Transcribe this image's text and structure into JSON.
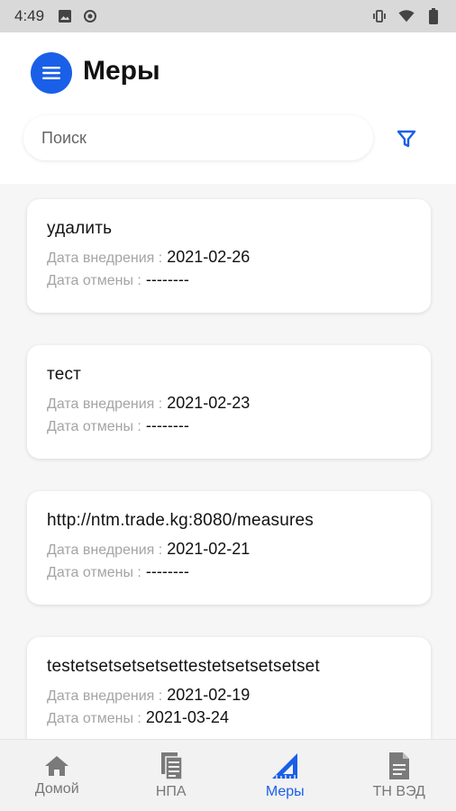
{
  "status_bar": {
    "time": "4:49",
    "left_icons": [
      "image-icon",
      "circle-dot-icon"
    ],
    "right_icons": [
      "vibrate-icon",
      "wifi-icon",
      "battery-icon"
    ]
  },
  "header": {
    "title": "Меры",
    "search_placeholder": "Поиск",
    "accent_color": "#1a5fe8"
  },
  "measures": [
    {
      "title": "удалить",
      "intro_label": "Дата внедрения :",
      "intro_date": "2021-02-26",
      "cancel_label": "Дата отмены :",
      "cancel_date": "--------"
    },
    {
      "title": "тест",
      "intro_label": "Дата внедрения :",
      "intro_date": "2021-02-23",
      "cancel_label": "Дата отмены :",
      "cancel_date": "--------"
    },
    {
      "title": "http://ntm.trade.kg:8080/measures",
      "intro_label": "Дата внедрения :",
      "intro_date": "2021-02-21",
      "cancel_label": "Дата отмены :",
      "cancel_date": "--------"
    },
    {
      "title": "testetsetsetsetsettestetsetsetsetset",
      "intro_label": "Дата внедрения :",
      "intro_date": "2021-02-19",
      "cancel_label": "Дата отмены :",
      "cancel_date": "2021-03-24"
    }
  ],
  "bottom_nav": {
    "items": [
      {
        "label": "Домой",
        "icon": "home-icon",
        "active": false
      },
      {
        "label": "НПА",
        "icon": "documents-icon",
        "active": false
      },
      {
        "label": "Меры",
        "icon": "ruler-triangle-icon",
        "active": true
      },
      {
        "label": "ТН ВЭД",
        "icon": "file-icon",
        "active": false
      }
    ]
  }
}
